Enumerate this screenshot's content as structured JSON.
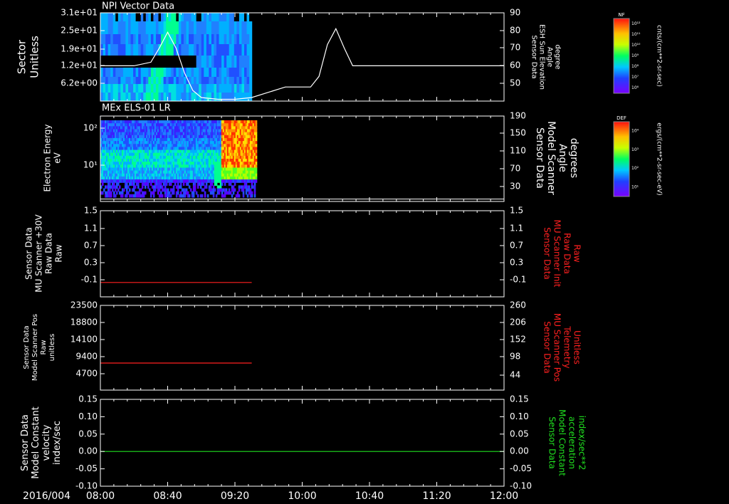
{
  "date_label": "2016/004",
  "colors": {
    "fg": "#ffffff",
    "red": "#ff2020",
    "green": "#20e020"
  },
  "chart_data": [
    {
      "type": "heatmap",
      "title": "NPI Vector Data",
      "ylabel_left": [
        "Sector",
        "Unitless"
      ],
      "yticks_left": [
        "3.1e+01",
        "2.5e+01",
        "1.9e+01",
        "1.2e+01",
        "6.2e+00"
      ],
      "ylabel_right": [
        "Sensor Data",
        "ESH Sun Elevation",
        "Angle",
        "degree"
      ],
      "yticks_right": [
        "90",
        "80",
        "70",
        "60",
        "50"
      ],
      "ylim_right": [
        40,
        90
      ],
      "colorbar": {
        "label": "NF",
        "units": "cnts/(cm**2-sr-sec)",
        "ticks": [
          "10¹²",
          "10¹¹",
          "10¹⁰",
          "10⁹",
          "10⁸",
          "10⁷",
          "10⁶"
        ]
      },
      "line": {
        "x": [
          "08:00",
          "08:20",
          "08:30",
          "08:35",
          "08:40",
          "08:45",
          "08:50",
          "08:55",
          "09:00",
          "09:10",
          "09:20",
          "09:30",
          "09:40",
          "09:50",
          "10:00",
          "10:05",
          "10:10",
          "10:15",
          "10:20",
          "10:25",
          "10:30",
          "12:00"
        ],
        "y": [
          60,
          60,
          62,
          70,
          79,
          70,
          56,
          46,
          42,
          41,
          41,
          42,
          45,
          48,
          48,
          48,
          54,
          72,
          81,
          70,
          60,
          60
        ]
      }
    },
    {
      "type": "heatmap",
      "title": "MEx ELS-01 LR",
      "ylabel_left": [
        "Electron Energy",
        "eV"
      ],
      "yticks_left": [
        "10²",
        "10¹"
      ],
      "ylabel_right": [
        "Sensor Data",
        "Model Scanner",
        "Angle",
        "degrees"
      ],
      "yticks_right": [
        "190",
        "150",
        "110",
        "70",
        "30"
      ],
      "ylim_right": [
        10,
        190
      ],
      "colorbar": {
        "label": "DEF",
        "units": "ergs/(cm**2-sr-sec-eV)",
        "ticks": [
          "10⁴",
          "10³",
          "10²",
          "10¹"
        ]
      },
      "line": {
        "x": [
          "08:00",
          "12:00"
        ],
        "y": [
          15,
          15
        ]
      }
    },
    {
      "type": "line",
      "ylabel_left": [
        "Sensor Data",
        "MU Scanner +30V",
        "Raw Data",
        "Raw"
      ],
      "yticks_left": [
        "1.5",
        "1.1",
        "0.7",
        "0.3",
        "-0.1"
      ],
      "ylim": [
        -0.3,
        1.5
      ],
      "ylabel_right": [
        "Sensor Data",
        "MU Scanner Init",
        "Raw Data",
        "Raw"
      ],
      "yticks_right": [
        "1.5",
        "1.1",
        "0.7",
        "0.3",
        "-0.1"
      ],
      "series": [
        {
          "x": [
            "08:00",
            "09:30"
          ],
          "y": [
            0.0,
            0.0
          ]
        }
      ]
    },
    {
      "type": "line",
      "ylabel_left": [
        "Sensor Data",
        "Model Scanner Pos",
        "Raw",
        "unitless"
      ],
      "yticks_left": [
        "23500",
        "18800",
        "14100",
        "9400",
        "4700"
      ],
      "ylim": [
        0,
        23500
      ],
      "ylabel_right": [
        "Sensor Data",
        "MU Scanner Pos",
        "Telemetry",
        "Unitless"
      ],
      "yticks_right": [
        "260",
        "206",
        "152",
        "98",
        "44"
      ],
      "series": [
        {
          "x": [
            "08:00",
            "09:30"
          ],
          "y": [
            7500,
            7500
          ]
        }
      ]
    },
    {
      "type": "line",
      "ylabel_left": [
        "Sensor Data",
        "Model Constant",
        "velocity",
        "index/sec"
      ],
      "yticks_left": [
        "0.15",
        "0.10",
        "0.05",
        "0.00",
        "-0.05",
        "-0.10"
      ],
      "ylim": [
        -0.1,
        0.15
      ],
      "ylabel_right": [
        "Sensor Data",
        "Model Constant",
        "acceleration",
        "index/sec**2"
      ],
      "yticks_right": [
        "0.15",
        "0.10",
        "0.05",
        "0.00",
        "-0.05",
        "-0.10"
      ],
      "series": [
        {
          "x": [
            "08:00",
            "12:00"
          ],
          "y": [
            0.0,
            0.0
          ]
        }
      ]
    }
  ],
  "xaxis": {
    "ticks": [
      "08:00",
      "08:40",
      "09:20",
      "10:00",
      "10:40",
      "11:20",
      "12:00"
    ]
  }
}
